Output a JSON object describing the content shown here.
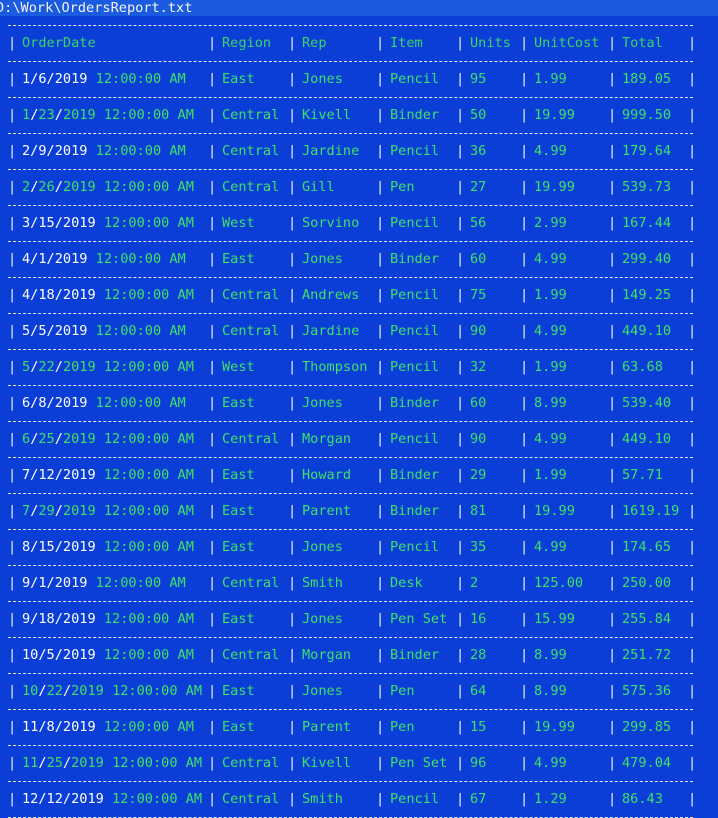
{
  "window": {
    "title": "D:\\Work\\OrdersReport.txt"
  },
  "table": {
    "headers": [
      "OrderDate",
      "Region",
      "Rep",
      "Item",
      "Units",
      "UnitCost",
      "Total"
    ],
    "rows": [
      {
        "date": "1/6/2019",
        "time": "12:00:00 AM",
        "region": "East",
        "rep": "Jones",
        "item": "Pencil",
        "units": "95",
        "unitcost": "1.99",
        "total": "189.05",
        "hl": "w"
      },
      {
        "date": "1/23/2019",
        "time": "12:00:00 AM",
        "region": "Central",
        "rep": "Kivell",
        "item": "Binder",
        "units": "50",
        "unitcost": "19.99",
        "total": "999.50",
        "hl": "p"
      },
      {
        "date": "2/9/2019",
        "time": "12:00:00 AM",
        "region": "Central",
        "rep": "Jardine",
        "item": "Pencil",
        "units": "36",
        "unitcost": "4.99",
        "total": "179.64",
        "hl": "w"
      },
      {
        "date": "2/26/2019",
        "time": "12:00:00 AM",
        "region": "Central",
        "rep": "Gill",
        "item": "Pen",
        "units": "27",
        "unitcost": "19.99",
        "total": "539.73",
        "hl": "p"
      },
      {
        "date": "3/15/2019",
        "time": "12:00:00 AM",
        "region": "West",
        "rep": "Sorvino",
        "item": "Pencil",
        "units": "56",
        "unitcost": "2.99",
        "total": "167.44",
        "hl": "w"
      },
      {
        "date": "4/1/2019",
        "time": "12:00:00 AM",
        "region": "East",
        "rep": "Jones",
        "item": "Binder",
        "units": "60",
        "unitcost": "4.99",
        "total": "299.40",
        "hl": "w"
      },
      {
        "date": "4/18/2019",
        "time": "12:00:00 AM",
        "region": "Central",
        "rep": "Andrews",
        "item": "Pencil",
        "units": "75",
        "unitcost": "1.99",
        "total": "149.25",
        "hl": "w"
      },
      {
        "date": "5/5/2019",
        "time": "12:00:00 AM",
        "region": "Central",
        "rep": "Jardine",
        "item": "Pencil",
        "units": "90",
        "unitcost": "4.99",
        "total": "449.10",
        "hl": "w"
      },
      {
        "date": "5/22/2019",
        "time": "12:00:00 AM",
        "region": "West",
        "rep": "Thompson",
        "item": "Pencil",
        "units": "32",
        "unitcost": "1.99",
        "total": "63.68",
        "hl": "p"
      },
      {
        "date": "6/8/2019",
        "time": "12:00:00 AM",
        "region": "East",
        "rep": "Jones",
        "item": "Binder",
        "units": "60",
        "unitcost": "8.99",
        "total": "539.40",
        "hl": "w"
      },
      {
        "date": "6/25/2019",
        "time": "12:00:00 AM",
        "region": "Central",
        "rep": "Morgan",
        "item": "Pencil",
        "units": "90",
        "unitcost": "4.99",
        "total": "449.10",
        "hl": "p"
      },
      {
        "date": "7/12/2019",
        "time": "12:00:00 AM",
        "region": "East",
        "rep": "Howard",
        "item": "Binder",
        "units": "29",
        "unitcost": "1.99",
        "total": "57.71",
        "hl": "w"
      },
      {
        "date": "7/29/2019",
        "time": "12:00:00 AM",
        "region": "East",
        "rep": "Parent",
        "item": "Binder",
        "units": "81",
        "unitcost": "19.99",
        "total": "1619.19",
        "hl": "p"
      },
      {
        "date": "8/15/2019",
        "time": "12:00:00 AM",
        "region": "East",
        "rep": "Jones",
        "item": "Pencil",
        "units": "35",
        "unitcost": "4.99",
        "total": "174.65",
        "hl": "w"
      },
      {
        "date": "9/1/2019",
        "time": "12:00:00 AM",
        "region": "Central",
        "rep": "Smith",
        "item": "Desk",
        "units": "2",
        "unitcost": "125.00",
        "total": "250.00",
        "hl": "w"
      },
      {
        "date": "9/18/2019",
        "time": "12:00:00 AM",
        "region": "East",
        "rep": "Jones",
        "item": "Pen Set",
        "units": "16",
        "unitcost": "15.99",
        "total": "255.84",
        "hl": "w"
      },
      {
        "date": "10/5/2019",
        "time": "12:00:00 AM",
        "region": "Central",
        "rep": "Morgan",
        "item": "Binder",
        "units": "28",
        "unitcost": "8.99",
        "total": "251.72",
        "hl": "w"
      },
      {
        "date": "10/22/2019",
        "time": "12:00:00 AM",
        "region": "East",
        "rep": "Jones",
        "item": "Pen",
        "units": "64",
        "unitcost": "8.99",
        "total": "575.36",
        "hl": "p"
      },
      {
        "date": "11/8/2019",
        "time": "12:00:00 AM",
        "region": "East",
        "rep": "Parent",
        "item": "Pen",
        "units": "15",
        "unitcost": "19.99",
        "total": "299.85",
        "hl": "w"
      },
      {
        "date": "11/25/2019",
        "time": "12:00:00 AM",
        "region": "Central",
        "rep": "Kivell",
        "item": "Pen Set",
        "units": "96",
        "unitcost": "4.99",
        "total": "479.04",
        "hl": "p"
      },
      {
        "date": "12/12/2019",
        "time": "12:00:00 AM",
        "region": "Central",
        "rep": "Smith",
        "item": "Pencil",
        "units": "67",
        "unitcost": "1.29",
        "total": "86.43",
        "hl": "w"
      }
    ]
  },
  "colors": {
    "background": "#0a3ed6",
    "cell_text": "#3ee06b",
    "highlight_text": "#ffffff",
    "border": "#e8e8e8"
  }
}
